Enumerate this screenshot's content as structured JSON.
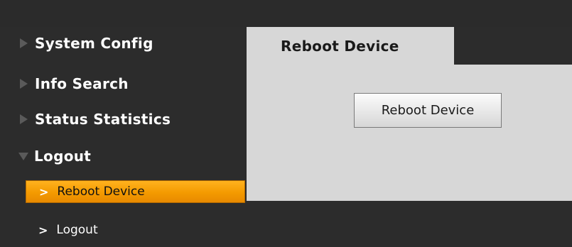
{
  "sidebar": {
    "items": [
      {
        "label": "System Config",
        "expanded": false
      },
      {
        "label": "Info Search",
        "expanded": false
      },
      {
        "label": "Status Statistics",
        "expanded": false
      },
      {
        "label": "Logout",
        "expanded": true
      }
    ],
    "subitems": [
      {
        "label": "Reboot Device",
        "active": true
      },
      {
        "label": "Logout",
        "active": false
      }
    ]
  },
  "main": {
    "tab_label": "Reboot Device",
    "button_label": "Reboot Device"
  },
  "colors": {
    "background": "#2c2c2c",
    "panel": "#d7d7d7",
    "active_accent": "#f49a00"
  }
}
